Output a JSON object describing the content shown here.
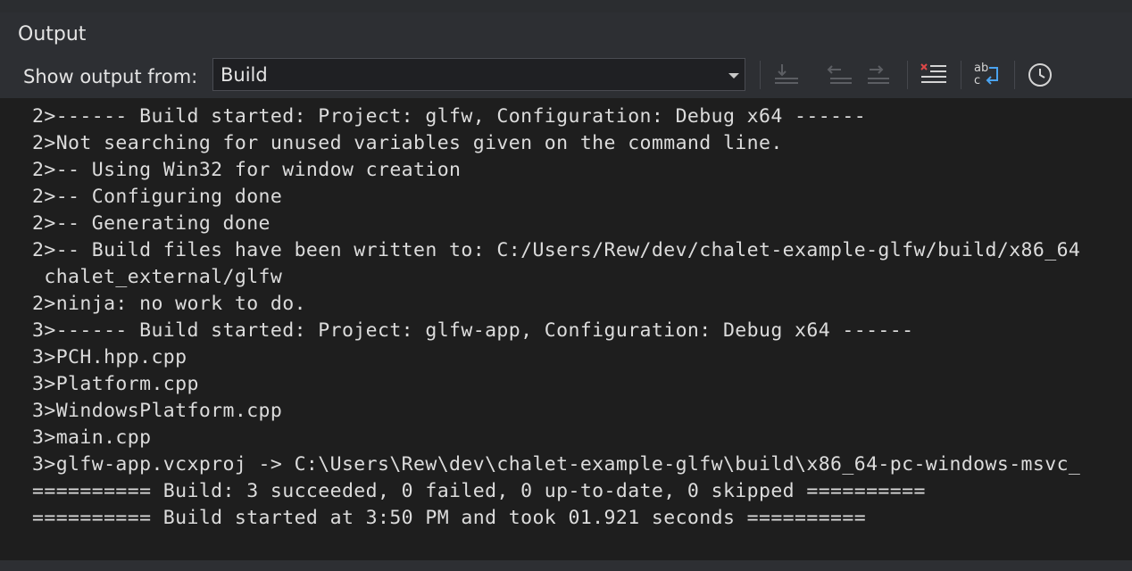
{
  "panel": {
    "title": "Output"
  },
  "toolbar": {
    "show_output_label": "Show output from:",
    "source_selected": "Build",
    "icons": [
      "goto-current-icon",
      "previous-message-icon",
      "next-message-icon",
      "clear-all-icon",
      "word-wrap-icon",
      "timestamp-clock-icon"
    ]
  },
  "output": {
    "lines": [
      "2>------ Build started: Project: glfw, Configuration: Debug x64 ------",
      "2>Not searching for unused variables given on the command line.",
      "2>-- Using Win32 for window creation",
      "2>-- Configuring done",
      "2>-- Generating done",
      "2>-- Build files have been written to: C:/Users/Rew/dev/chalet-example-glfw/build/x86_64",
      " chalet_external/glfw",
      "2>ninja: no work to do.",
      "3>------ Build started: Project: glfw-app, Configuration: Debug x64 ------",
      "3>PCH.hpp.cpp",
      "3>Platform.cpp",
      "3>WindowsPlatform.cpp",
      "3>main.cpp",
      "3>glfw-app.vcxproj -> C:\\Users\\Rew\\dev\\chalet-example-glfw\\build\\x86_64-pc-windows-msvc_",
      "========== Build: 3 succeeded, 0 failed, 0 up-to-date, 0 skipped ==========",
      "========== Build started at 3:50 PM and took 01.921 seconds =========="
    ]
  },
  "colors": {
    "panel_bg": "#2d2f33",
    "output_bg": "#1e1e1e",
    "text": "#dcdcdc",
    "accent_red": "#e04848",
    "accent_blue": "#4aa3f0"
  }
}
